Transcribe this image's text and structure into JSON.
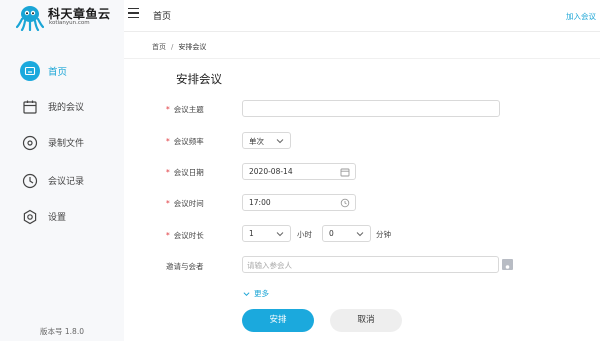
{
  "app": {
    "logo_name": "科天章鱼云",
    "logo_domain": "kotianyun.com"
  },
  "sidebar": {
    "items": [
      {
        "label": "首页",
        "icon": "home-icon"
      },
      {
        "label": "我的会议",
        "icon": "calendar-icon"
      },
      {
        "label": "录制文件",
        "icon": "record-icon"
      },
      {
        "label": "会议记录",
        "icon": "clock-icon"
      },
      {
        "label": "设置",
        "icon": "gear-icon"
      }
    ],
    "version": "版本号 1.8.0"
  },
  "header": {
    "title": "首页",
    "join_label": "加入会议"
  },
  "breadcrumb": {
    "home": "首页",
    "separator": "/",
    "current": "安排会议"
  },
  "form": {
    "title": "安排会议",
    "topic": {
      "label": "会议主题",
      "value": "",
      "placeholder": ""
    },
    "frequency": {
      "label": "会议频率",
      "value": "单次"
    },
    "date": {
      "label": "会议日期",
      "value": "2020-08-14"
    },
    "time": {
      "label": "会议时间",
      "value": "17:00"
    },
    "duration": {
      "label": "会议时长",
      "hours": "1",
      "hours_unit": "小时",
      "minutes": "0",
      "minutes_unit": "分钟"
    },
    "invite": {
      "label": "邀请与会者",
      "placeholder": "请输入参会人"
    },
    "more_label": "更多",
    "submit_label": "安排",
    "cancel_label": "取消"
  },
  "colors": {
    "accent": "#1ba9dd",
    "required": "#e0393e"
  }
}
